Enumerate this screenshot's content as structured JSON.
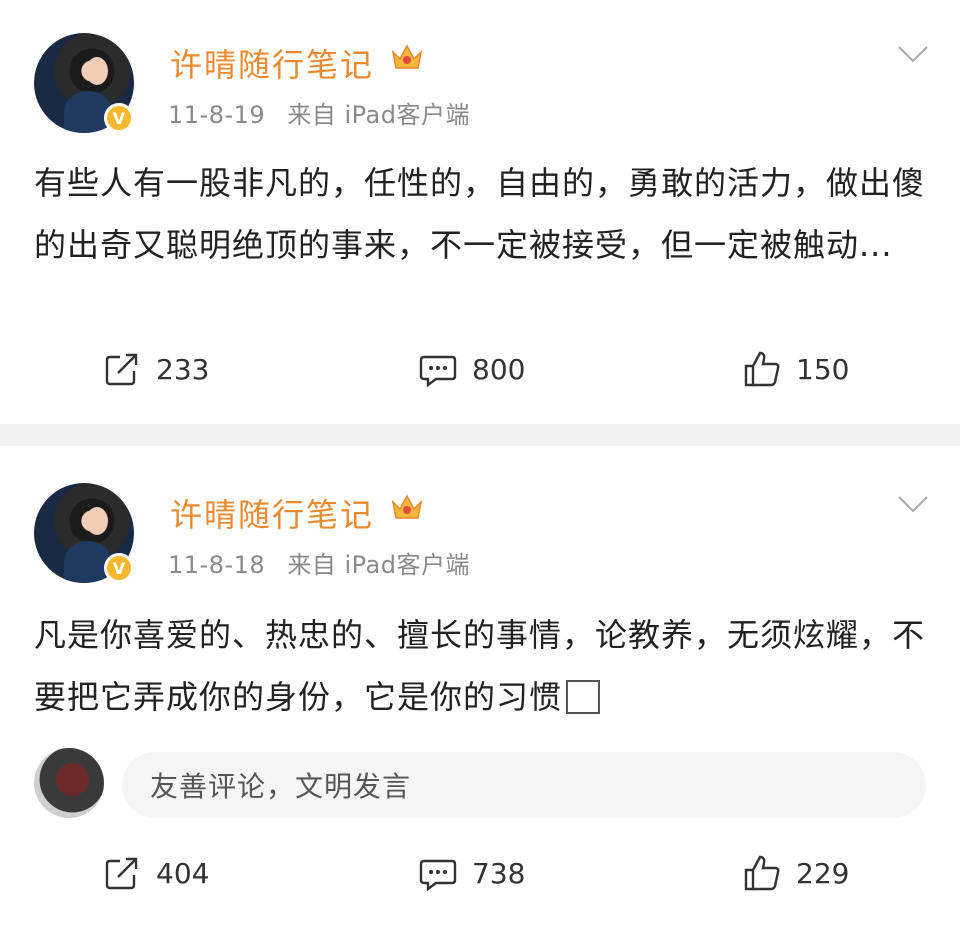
{
  "posts": [
    {
      "username": "许晴随行笔记",
      "time": "11-8-19",
      "source": "来自 iPad客户端",
      "content": "有些人有一股非凡的，任性的，自由的，勇敢的活力，做出傻的出奇又聪明绝顶的事来，不一定被接受，但一定被触动...",
      "reposts": "233",
      "comments": "800",
      "likes": "150"
    },
    {
      "username": "许晴随行笔记",
      "time": "11-8-18",
      "source": "来自 iPad客户端",
      "content": "凡是你喜爱的、热忠的、擅长的事情，论教养，无须炫耀，不要把它弄成你的身份，它是你的习惯",
      "comment_placeholder": "友善评论，文明发言",
      "reposts": "404",
      "comments": "738",
      "likes": "229"
    }
  ],
  "icons": {
    "repost": "repost-icon",
    "comment": "comment-icon",
    "like": "thumbs-up-icon",
    "menu": "chevron-down-icon",
    "vip": "crown-icon",
    "verified": "verified-badge-icon"
  },
  "colors": {
    "username": "#ea8a2f",
    "meta": "#8a8a8a",
    "separator": "#f2f2f2",
    "verified": "#f5b82e"
  }
}
